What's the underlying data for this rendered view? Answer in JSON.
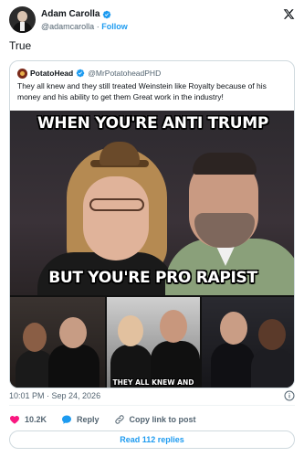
{
  "author": {
    "name": "Adam Carolla",
    "handle": "@adamcarolla",
    "separator": "·",
    "follow_label": "Follow"
  },
  "tweet": {
    "text": "True",
    "timestamp": "10:01 PM · Sep 24, 2026"
  },
  "quoted": {
    "name": "PotatoHead",
    "handle": "@MrPotatoheadPHD",
    "text": "They all knew and they still treated Weinstein like Royalty because of his money and his ability to get them Great work in the industry!",
    "meme": {
      "caption_top": "WHEN YOU'RE ANTI TRUMP",
      "caption_bottom": "BUT YOU'RE PRO RAPIST",
      "panel_caption": "THEY ALL KNEW AND"
    }
  },
  "actions": {
    "likes": "10.2K",
    "reply_label": "Reply",
    "copy_label": "Copy link to post",
    "read_replies": "Read 112 replies"
  },
  "colors": {
    "accent": "#1d9bf0",
    "like": "#f91880",
    "muted": "#536471"
  },
  "icons": {
    "verified": "verified-badge-icon",
    "x_logo": "x-logo-icon",
    "info": "info-icon",
    "heart": "heart-icon",
    "reply": "reply-bubble-icon",
    "link": "link-icon"
  }
}
